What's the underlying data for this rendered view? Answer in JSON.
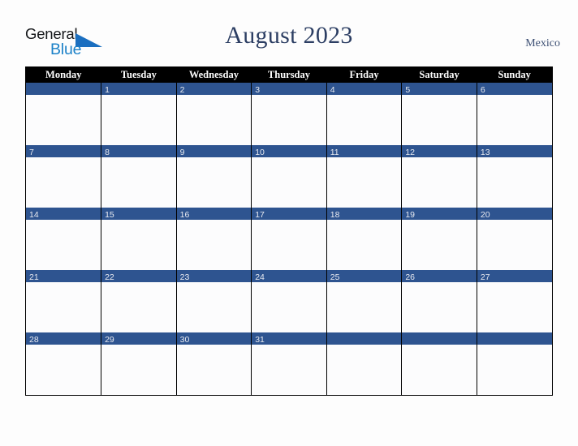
{
  "brand": {
    "name_part1": "General",
    "name_part2": "Blue",
    "flag_icon": "triangle-flag-icon",
    "color_dark": "#15171a",
    "color_blue": "#1b81c8"
  },
  "header": {
    "title": "August 2023",
    "country": "Mexico"
  },
  "colors": {
    "page_background": "#fdfdfd",
    "header_row_background": "#000000",
    "header_row_text": "#ffffff",
    "date_bar_background": "#2e5490",
    "date_number_text": "#e8eaf0",
    "cell_background": "#fcfcfd",
    "grid_border": "#000000",
    "title_text": "#2c3e63",
    "country_text": "#3c4f73"
  },
  "calendar": {
    "month": "August",
    "year": "2023",
    "weekday_headers": [
      "Monday",
      "Tuesday",
      "Wednesday",
      "Thursday",
      "Friday",
      "Saturday",
      "Sunday"
    ],
    "weeks": [
      [
        "",
        "1",
        "2",
        "3",
        "4",
        "5",
        "6"
      ],
      [
        "7",
        "8",
        "9",
        "10",
        "11",
        "12",
        "13"
      ],
      [
        "14",
        "15",
        "16",
        "17",
        "18",
        "19",
        "20"
      ],
      [
        "21",
        "22",
        "23",
        "24",
        "25",
        "26",
        "27"
      ],
      [
        "28",
        "29",
        "30",
        "31",
        "",
        "",
        ""
      ]
    ]
  }
}
